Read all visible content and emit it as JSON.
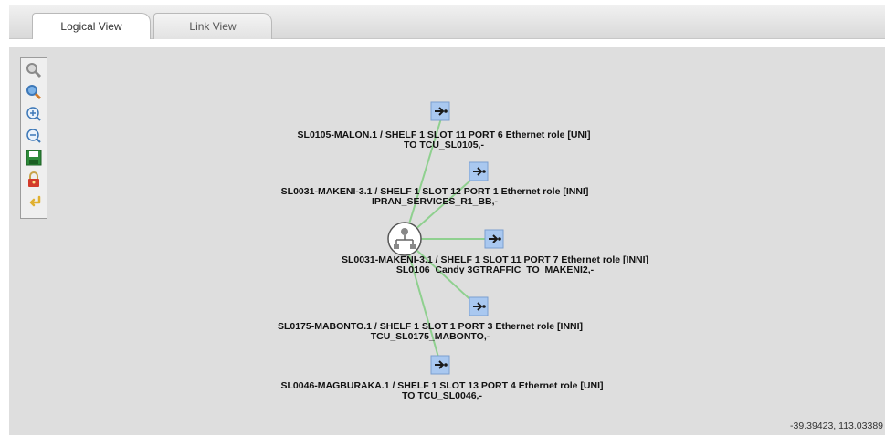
{
  "tabs": [
    {
      "label": "Logical View",
      "active": true
    },
    {
      "label": "Link View",
      "active": false
    }
  ],
  "toolbar": {
    "tools": [
      {
        "name": "zoom-region-icon"
      },
      {
        "name": "zoom-fit-icon"
      },
      {
        "name": "zoom-in-icon"
      },
      {
        "name": "zoom-out-icon"
      },
      {
        "name": "save-icon"
      },
      {
        "name": "lock-icon"
      },
      {
        "name": "back-arrow-icon"
      }
    ]
  },
  "graph": {
    "center_node": {
      "name": "network-hub-icon"
    },
    "ports": [
      {
        "line1": "SL0105-MALON.1 / SHELF 1 SLOT 11 PORT 6 Ethernet role [UNI]",
        "line2": "TO TCU_SL0105,-"
      },
      {
        "line1": "SL0031-MAKENI-3.1 / SHELF 1 SLOT 12 PORT 1 Ethernet role [INNI]",
        "line2": "IPRAN_SERVICES_R1_BB,-"
      },
      {
        "line1": "SL0031-MAKENI-3.1 / SHELF 1 SLOT 11 PORT 7 Ethernet role [INNI]",
        "line2": "SL0106_Candy 3GTRAFFIC_TO_MAKENI2,-"
      },
      {
        "line1": "SL0175-MABONTO.1 / SHELF 1 SLOT 1 PORT 3 Ethernet role [INNI]",
        "line2": "TCU_SL0175_MABONTO,-"
      },
      {
        "line1": "SL0046-MAGBURAKA.1 / SHELF 1 SLOT 13 PORT 4 Ethernet role [UNI]",
        "line2": "TO TCU_SL0046,-"
      }
    ],
    "link_color": "#8fd08f",
    "port_icon_color": "#a9c8f0"
  },
  "status": {
    "coordinates": "-39.39423, 113.03389"
  }
}
